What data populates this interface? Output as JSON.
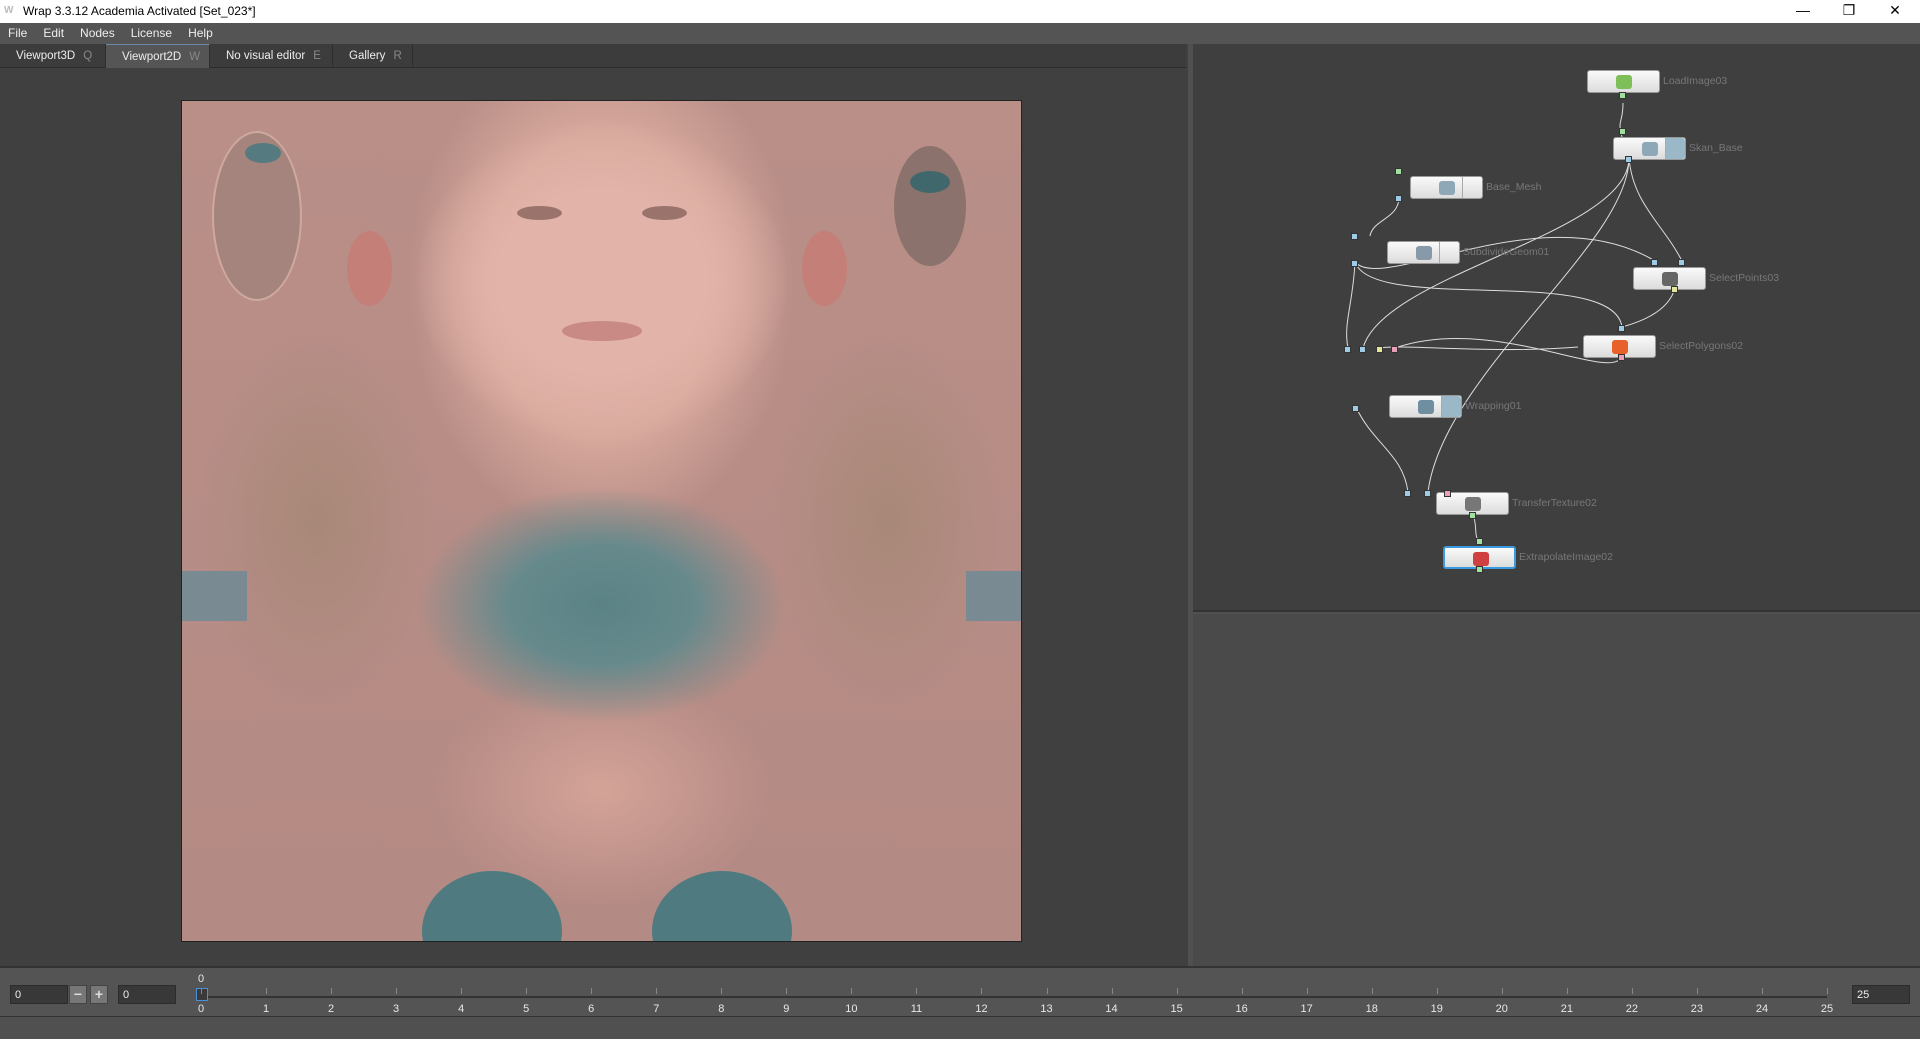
{
  "window": {
    "title": "Wrap 3.3.12 Academia Activated [Set_023*]",
    "logo": "W",
    "controls": [
      "minimize-icon",
      "restore-icon",
      "close-icon"
    ]
  },
  "menu": [
    "File",
    "Edit",
    "Nodes",
    "License",
    "Help"
  ],
  "tabs": [
    {
      "label": "Viewport3D",
      "key": "Q"
    },
    {
      "label": "Viewport2D",
      "key": "W",
      "active": true
    },
    {
      "label": "No visual editor",
      "key": "E"
    },
    {
      "label": "Gallery",
      "key": "R"
    }
  ],
  "nodes": [
    {
      "name": "LoadImage03",
      "icon": "image-icon",
      "color": "#7fbf5a"
    },
    {
      "name": "Skan_Base",
      "icon": "geometry-icon",
      "color": "#8fa8b8"
    },
    {
      "name": "Base_Mesh",
      "icon": "geometry-icon",
      "color": "#8fa8b8"
    },
    {
      "name": "SubdivideGeom01",
      "icon": "subdivide-icon",
      "color": "#8899aa"
    },
    {
      "name": "SelectPoints03",
      "icon": "select-points-icon",
      "color": "#666"
    },
    {
      "name": "SelectPolygons02",
      "icon": "select-polygons-icon",
      "color": "#e8602a"
    },
    {
      "name": "Wrapping01",
      "icon": "wrapping-icon",
      "color": "#6f8fa0"
    },
    {
      "name": "TransferTexture02",
      "icon": "transfer-texture-icon",
      "color": "#777"
    },
    {
      "name": "ExtrapolateImage02",
      "icon": "extrapolate-image-icon",
      "color": "#d04040",
      "selected": true
    }
  ],
  "port_colors": {
    "geometry": "#9fcbe6",
    "image": "#9fe0a0",
    "points": "#e6e69a",
    "polygons": "#e8a0b8"
  },
  "timeline": {
    "start": "0",
    "current": "0",
    "end": "25",
    "current_marker": "0",
    "ticks": [
      "0",
      "1",
      "2",
      "3",
      "4",
      "5",
      "6",
      "7",
      "8",
      "9",
      "10",
      "11",
      "12",
      "13",
      "14",
      "15",
      "16",
      "17",
      "18",
      "19",
      "20",
      "21",
      "22",
      "23",
      "24",
      "25"
    ],
    "decrement": "−",
    "increment": "+"
  }
}
